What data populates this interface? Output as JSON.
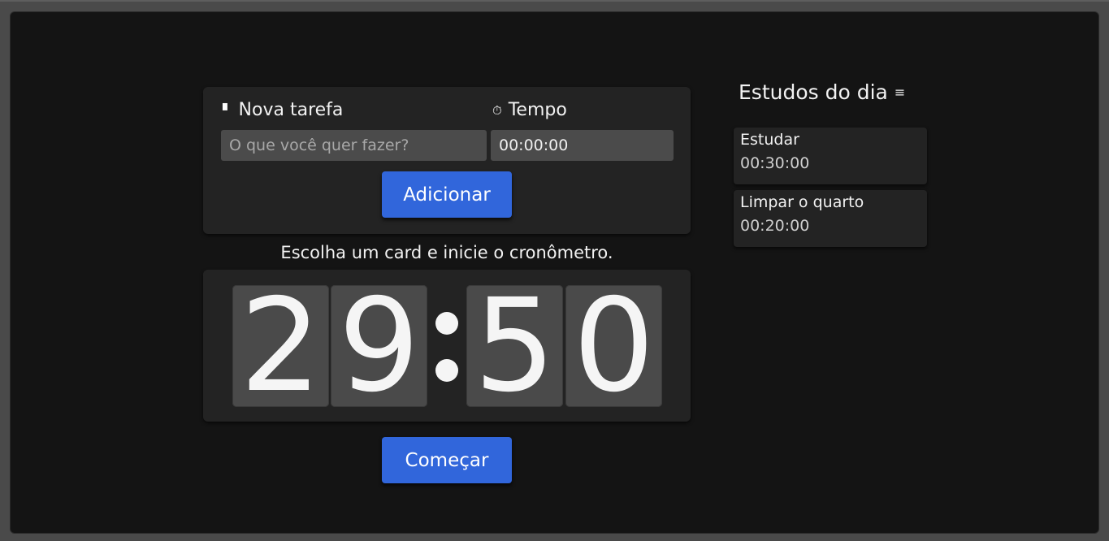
{
  "form": {
    "task_label": "Nova tarefa",
    "task_icon": "notebook-icon",
    "task_placeholder": "O que você quer fazer?",
    "task_value": "",
    "time_label": "Tempo",
    "time_icon": "stopwatch-icon",
    "time_value": "00:00:00",
    "add_button": "Adicionar"
  },
  "timer": {
    "hint": "Escolha um card e inicie o cronômetro.",
    "digits": [
      "2",
      "9",
      "5",
      "0"
    ],
    "start_button": "Começar"
  },
  "sidebar": {
    "title": "Estudos do dia",
    "title_icon": "list-icon",
    "tasks": [
      {
        "name": "Estudar",
        "time": "00:30:00"
      },
      {
        "name": "Limpar o quarto",
        "time": "00:20:00"
      }
    ]
  },
  "colors": {
    "background": "#141414",
    "card": "#232323",
    "input": "#4b4b4b",
    "button": "#3166db",
    "text": "#f2f2f2"
  }
}
